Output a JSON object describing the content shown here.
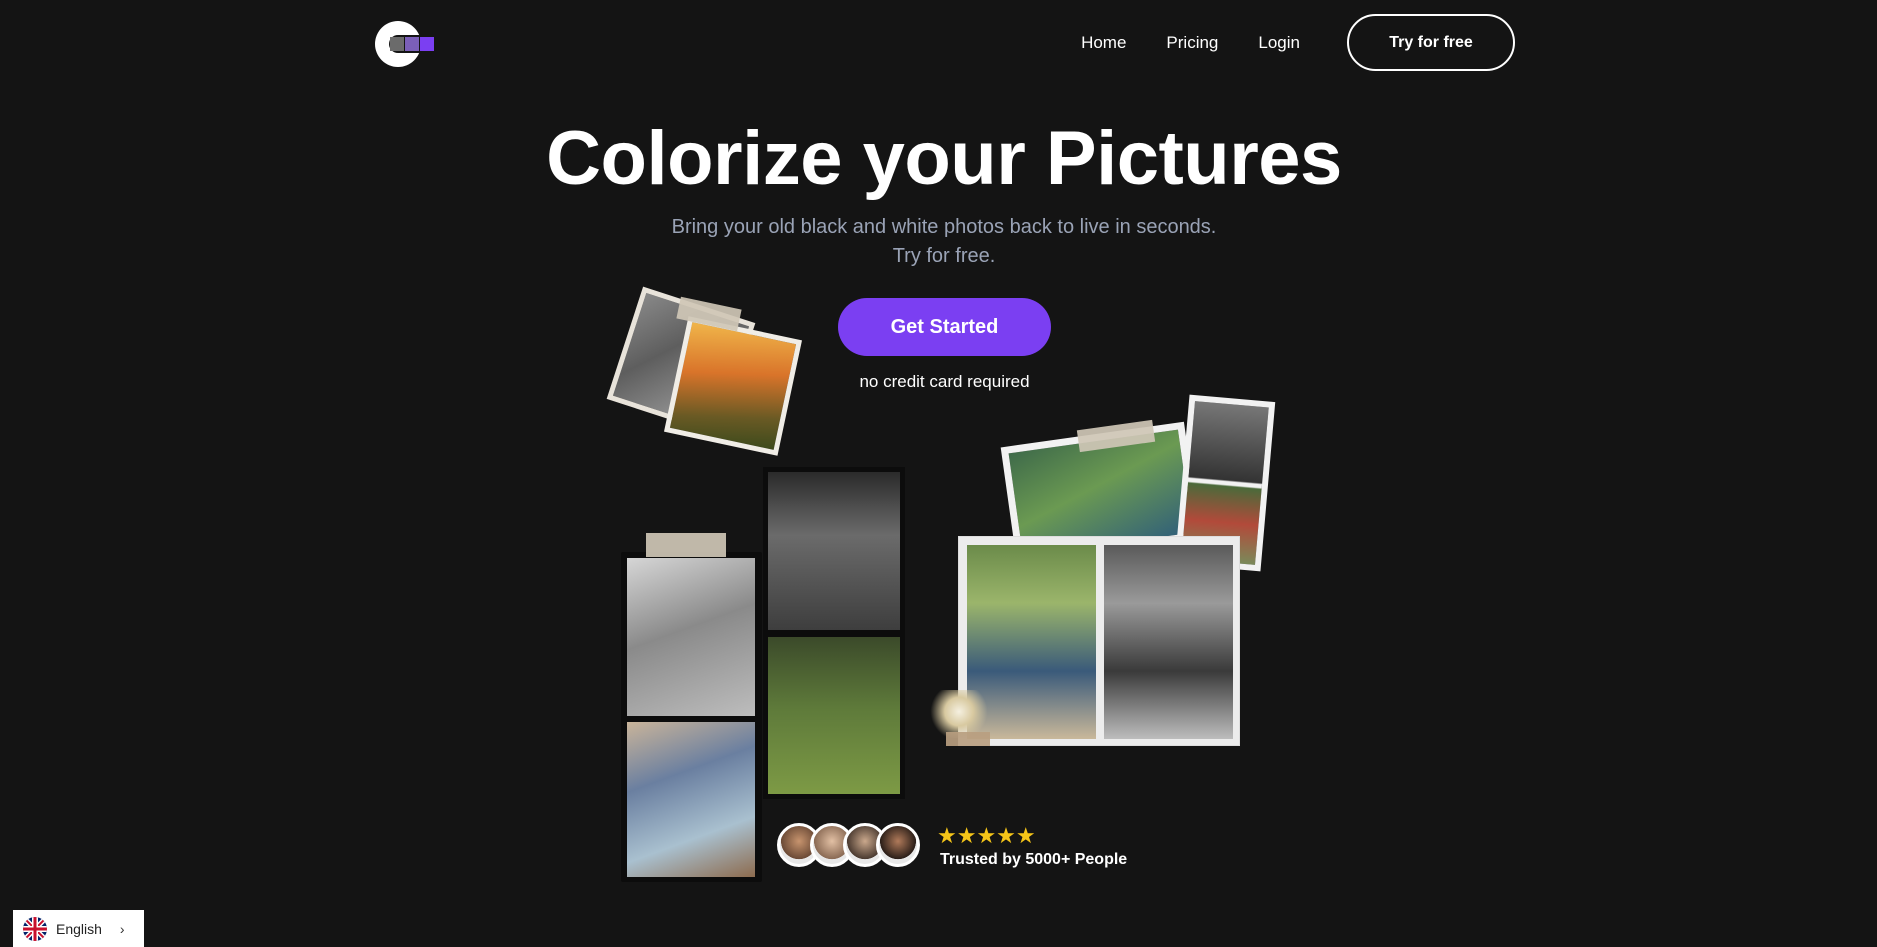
{
  "header": {
    "nav": {
      "home": "Home",
      "pricing": "Pricing",
      "login": "Login"
    },
    "cta": "Try for free"
  },
  "hero": {
    "title": "Colorize your Pictures",
    "subtitle_line1": "Bring your old black and white photos back to live in seconds.",
    "subtitle_line2": "Try for free.",
    "button": "Get Started",
    "note": "no credit card required"
  },
  "social_proof": {
    "stars": "★★★★★",
    "text": "Trusted by 5000+ People"
  },
  "language": {
    "label": "English",
    "icon": "uk-flag-icon"
  },
  "colors": {
    "background": "#141414",
    "accent": "#7b3ff2",
    "star": "#f5c518",
    "subtitle": "#9aa3b6"
  }
}
